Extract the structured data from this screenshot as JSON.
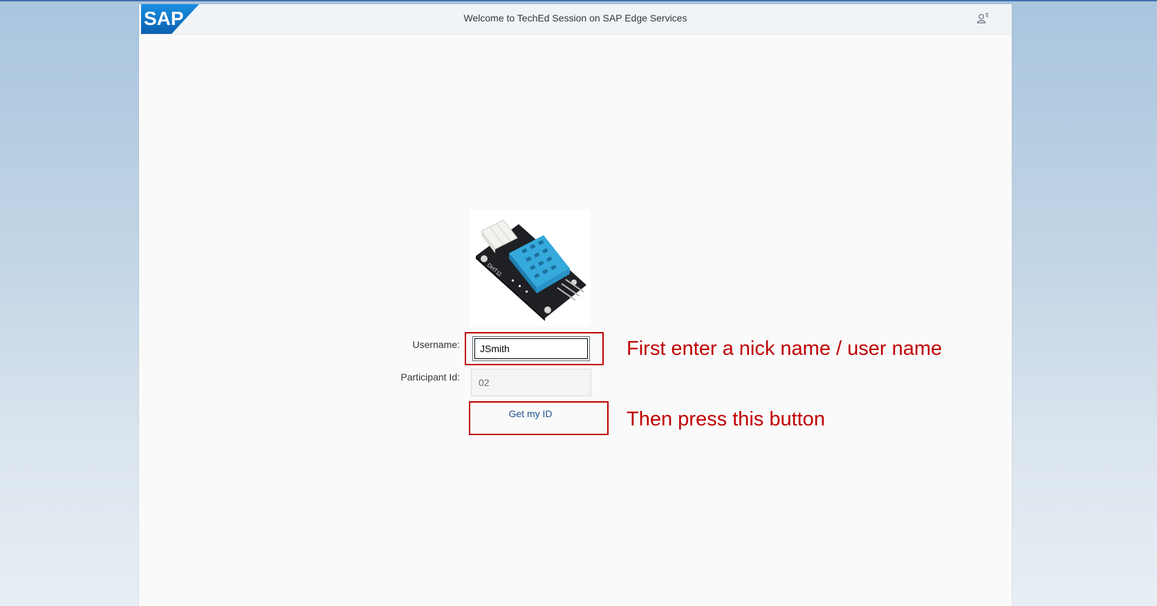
{
  "header": {
    "logo_text": "SAP",
    "title": "Welcome to TechEd Session on SAP Edge Services",
    "user_icon": "user-settings-icon"
  },
  "colors": {
    "brand_blue": "#0070c0",
    "annotation_red": "#c00000",
    "shell_bg": "#fafafa"
  },
  "form": {
    "image_alt": "DHT11 temperature and humidity sensor module",
    "sensor_marking": "DHT11",
    "username_label": "Username:",
    "username_value": "JSmith",
    "participant_label": "Participant Id:",
    "participant_value": "02",
    "button_label": "Get my ID"
  },
  "annotations": {
    "step1": "First enter a nick name / user name",
    "step2": "Then press this button"
  }
}
